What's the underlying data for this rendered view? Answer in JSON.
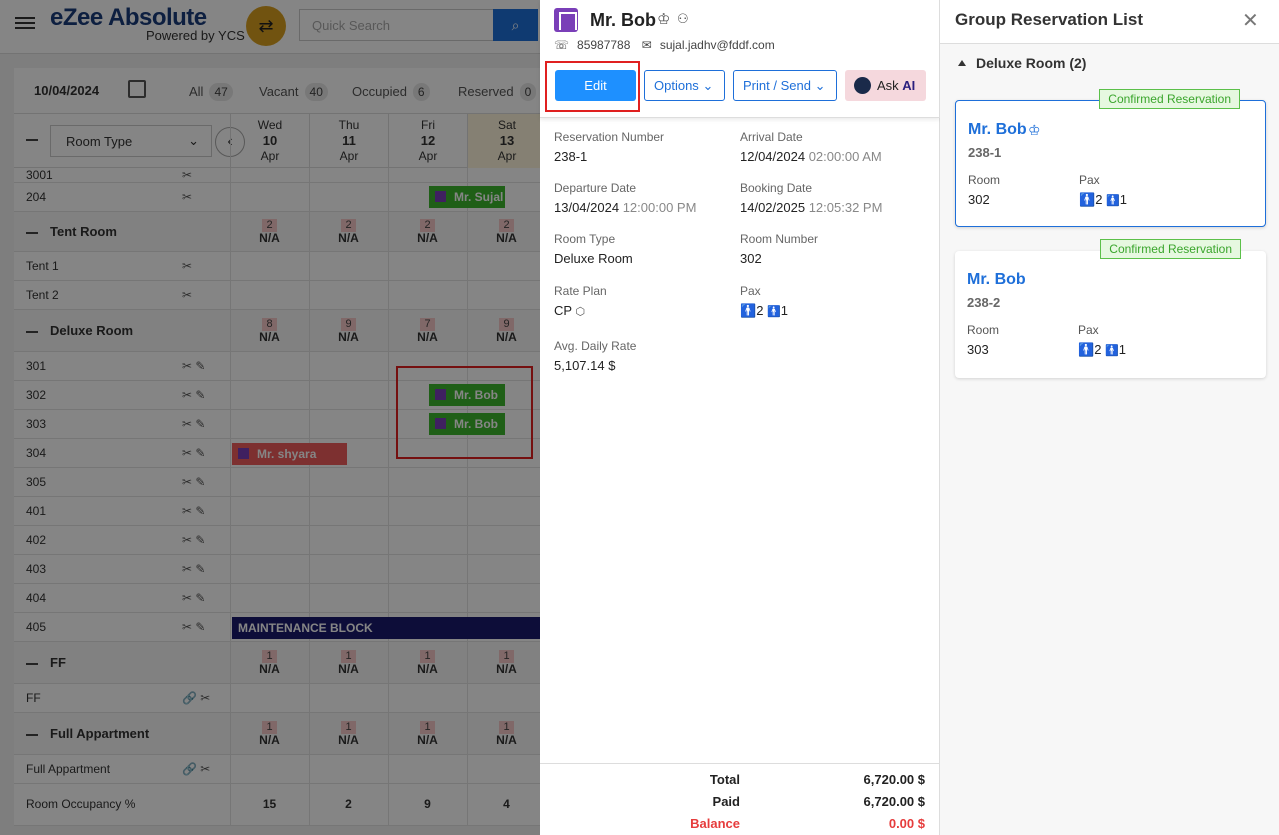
{
  "app": {
    "brand": "eZee Absolute",
    "brand_sub": "Powered by YCS",
    "search_placeholder": "Quick Search"
  },
  "filters": {
    "date": "10/04/2024",
    "items": [
      {
        "label": "All",
        "count": "47"
      },
      {
        "label": "Vacant",
        "count": "40"
      },
      {
        "label": "Occupied",
        "count": "6"
      },
      {
        "label": "Reserved",
        "count": "0"
      }
    ]
  },
  "grid": {
    "room_type_select": "Room Type",
    "days": [
      {
        "dow": "Wed",
        "day": "10",
        "mon": "Apr"
      },
      {
        "dow": "Thu",
        "day": "11",
        "mon": "Apr"
      },
      {
        "dow": "Fri",
        "day": "12",
        "mon": "Apr"
      },
      {
        "dow": "Sat",
        "day": "13",
        "mon": "Apr"
      }
    ],
    "rows": {
      "r3001": "3001",
      "r204": "204",
      "tent_group": "Tent Room",
      "tent1": "Tent 1",
      "tent2": "Tent 2",
      "deluxe_group": "Deluxe Room",
      "r301": "301",
      "r302": "302",
      "r303": "303",
      "r304": "304",
      "r305": "305",
      "r401": "401",
      "r402": "402",
      "r403": "403",
      "r404": "404",
      "r405": "405",
      "ff_group": "FF",
      "ff": "FF",
      "fa_group": "Full Appartment",
      "fa": "Full Appartment",
      "occupancy": "Room Occupancy %"
    },
    "tent_avail": [
      "2",
      "2",
      "2",
      "2"
    ],
    "deluxe_avail": [
      "8",
      "9",
      "7",
      "9"
    ],
    "ff_avail": [
      "1",
      "1",
      "1",
      "1"
    ],
    "fa_avail": [
      "1",
      "1",
      "1",
      "1"
    ],
    "na": "N/A",
    "occupancy": [
      "15",
      "2",
      "9",
      "4"
    ],
    "bars": {
      "sujal": "Mr. Sujal",
      "bob1": "Mr. Bob",
      "bob2": "Mr. Bob",
      "shyara": "Mr. shyara",
      "maintenance": "MAINTENANCE BLOCK"
    }
  },
  "detail": {
    "guest_name": "Mr. Bob",
    "phone": "85987788",
    "email": "sujal.jadhv@fddf.com",
    "buttons": {
      "edit": "Edit",
      "options": "Options",
      "print": "Print / Send",
      "ask": "Ask",
      "ai": "AI"
    },
    "fields": {
      "reservation_number_label": "Reservation Number",
      "reservation_number": "238-1",
      "arrival_label": "Arrival Date",
      "arrival_date": "12/04/2024",
      "arrival_time": "02:00:00 AM",
      "departure_label": "Departure Date",
      "departure_date": "13/04/2024",
      "departure_time": "12:00:00 PM",
      "booking_label": "Booking Date",
      "booking_date": "14/02/2025",
      "booking_time": "12:05:32 PM",
      "room_type_label": "Room Type",
      "room_type": "Deluxe Room",
      "room_number_label": "Room Number",
      "room_number": "302",
      "rate_plan_label": "Rate Plan",
      "rate_plan": "CP",
      "pax_label": "Pax",
      "pax_adult": "2",
      "pax_child": "1",
      "adr_label": "Avg. Daily Rate",
      "adr": "5,107.14 $"
    },
    "totals": {
      "total_label": "Total",
      "total": "6,720.00 $",
      "paid_label": "Paid",
      "paid": "6,720.00 $",
      "balance_label": "Balance",
      "balance": "0.00 $"
    }
  },
  "group_list": {
    "title": "Group Reservation List",
    "section": "Deluxe Room (2)",
    "cards": [
      {
        "badge": "Confirmed Reservation",
        "name": "Mr. Bob",
        "number": "238-1",
        "room_label": "Room",
        "room": "302",
        "pax_label": "Pax",
        "adult": "2",
        "child": "1"
      },
      {
        "badge": "Confirmed Reservation",
        "name": "Mr. Bob",
        "number": "238-2",
        "room_label": "Room",
        "room": "303",
        "pax_label": "Pax",
        "adult": "2",
        "child": "1"
      }
    ]
  },
  "colors": {
    "accent": "#1e6fd9",
    "edit_button": "#1e90ff",
    "confirmed": "#3aa52c",
    "balance": "#e63c3c",
    "booking_green": "#3cb72c"
  }
}
